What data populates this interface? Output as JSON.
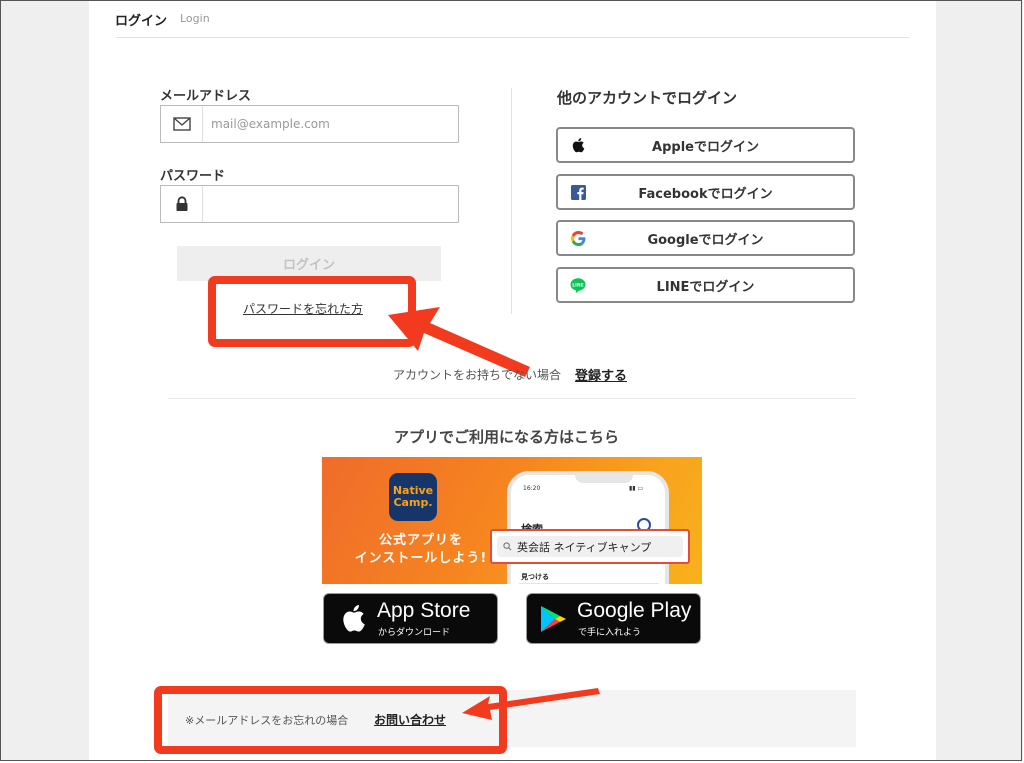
{
  "header": {
    "title": "ログイン",
    "subtitle": "Login"
  },
  "form": {
    "email_label": "メールアドレス",
    "email_placeholder": "mail@example.com",
    "email_value": "",
    "password_label": "パスワード",
    "password_value": "",
    "login_button": "ログイン",
    "forgot_link": "パスワードを忘れた方"
  },
  "social": {
    "title": "他のアカウントでログイン",
    "buttons": [
      {
        "label": "Appleでログイン",
        "icon": "apple-icon"
      },
      {
        "label": "Facebookでログイン",
        "icon": "facebook-icon"
      },
      {
        "label": "Googleでログイン",
        "icon": "google-icon"
      },
      {
        "label": "LINEでログイン",
        "icon": "line-icon"
      }
    ]
  },
  "signup": {
    "text": "アカウントをお持ちでない場合",
    "link": "登録する"
  },
  "app": {
    "title": "アプリでご利用になる方はこちら",
    "banner": {
      "logo_line1": "Native",
      "logo_line2": "Camp.",
      "line1": "公式アプリを",
      "line2": "インストールしよう!",
      "phone_time": "16:20",
      "phone_heading": "検索",
      "phone_search": "英会話 ネイティブキャンプ",
      "phone_find": "見つける"
    },
    "app_store": {
      "main": "App Store",
      "sub": "からダウンロード"
    },
    "google_play": {
      "main": "Google Play",
      "sub": "で手に入れよう"
    }
  },
  "notice": {
    "text": "※メールアドレスをお忘れの場合",
    "link": "お問い合わせ"
  },
  "colors": {
    "highlight": "#f23a1e",
    "banner_orange": "#f6851f",
    "logo_navy": "#16356b"
  }
}
